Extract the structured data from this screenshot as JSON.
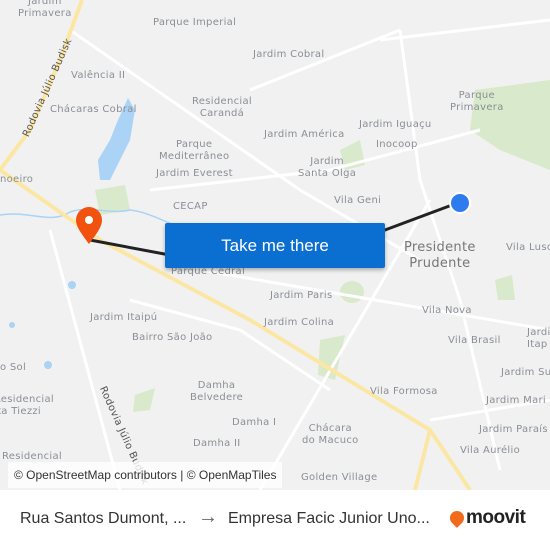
{
  "map": {
    "labels": {
      "jardim_primavera": "Jardim\nPrimavera",
      "parque_imperial": "Parque Imperial",
      "jardim_cobral": "Jardim Cobral",
      "valencia": "Valência II",
      "chacaras_cobral": "Chácaras Cobral",
      "residencial_caranda": "Residencial\nCarandá",
      "parque_mediterraneo": "Parque\nMediterrâneo",
      "jardim_everest": "Jardim Everest",
      "jardim_america": "Jardim América",
      "jardim_iguacu": "Jardim Iguaçu",
      "inocoop": "Inocoop",
      "jardim_santa_olga": "Jardim\nSanta Olga",
      "parque_primavera": "Parque\nPrimavera",
      "vila_geni": "Vila Geni",
      "cecap": "CECAP",
      "presidente_prudente": "Presidente\nPrudente",
      "vila_luso": "Vila Luso",
      "parque_cedral": "Parque Cedral",
      "jardim_paris": "Jardim Paris",
      "jardim_colina": "Jardim Colina",
      "jardim_itaipu": "Jardim Itaipú",
      "bairro_sao_joao": "Bairro São João",
      "vila_nova": "Vila Nova",
      "vila_brasil": "Vila Brasil",
      "jardim_itap": "Jardim\nItap",
      "jardim_su": "Jardim Su",
      "jardim_mari": "Jardim Mari",
      "jardim_paraiso": "Jardim Paraís",
      "vila_formosa": "Vila Formosa",
      "vila_aurelio": "Vila Aurélio",
      "damha_belvedere": "Damha\nBelvedere",
      "damha_i": "Damha I",
      "damha_ii": "Damha II",
      "chacara_macuco": "Chácara\ndo Macuco",
      "golden_village": "Golden Village",
      "o_sol": "o Sol",
      "residencial_tiezzi": "Residencial\nita Tiezzi",
      "residencial": "Residencial",
      "noeiro": "noeiro",
      "rodovia_top": "Rodovia Júlio Budisk",
      "rodovia_bottom": "Rodovia Júlio Budisk"
    },
    "attribution": "© OpenStreetMap contributors | © OpenMapTiles",
    "cta_label": "Take me there",
    "colors": {
      "origin": "#2e7bf0",
      "destination": "#f2520f",
      "cta": "#0a6fd1",
      "highway": "#fbe7a3",
      "water": "#aad3f5",
      "park": "#d4e8c4"
    }
  },
  "route": {
    "from": "Rua Santos Dumont, ...",
    "to": "Empresa Facic Junior Uno...",
    "arrow_icon": "arrow-right-icon"
  },
  "brand": {
    "name": "moovit"
  }
}
